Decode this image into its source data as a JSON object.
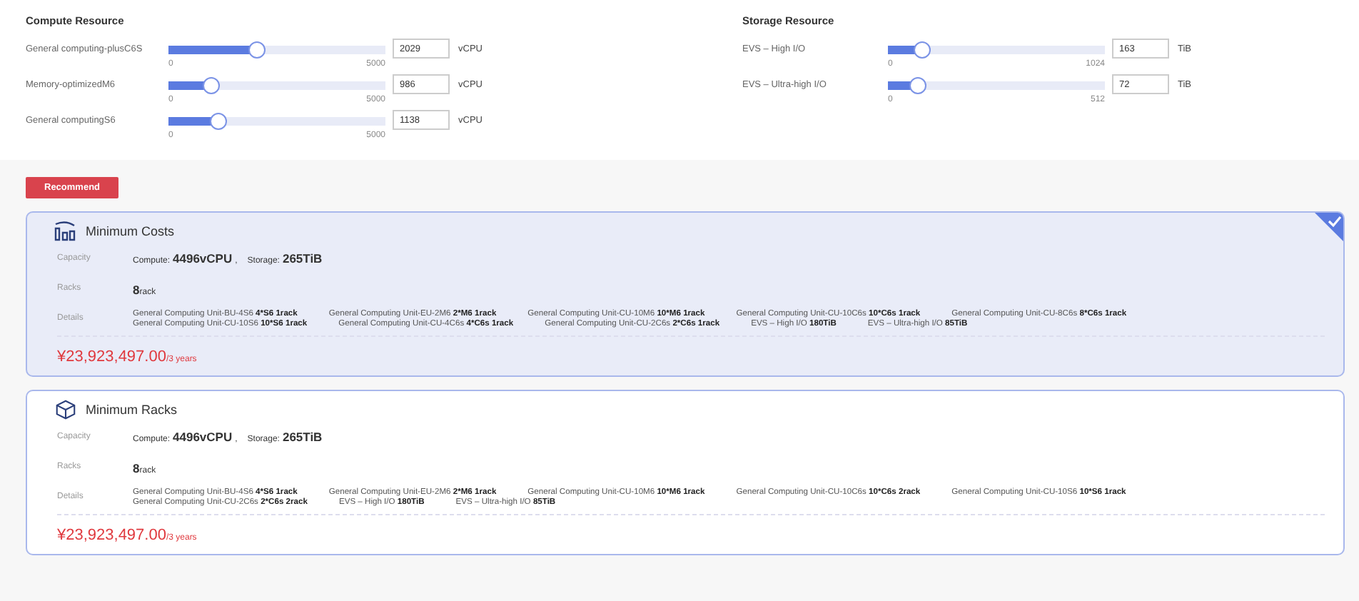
{
  "resource_groups": [
    {
      "title": "Compute Resource",
      "sliders": [
        {
          "label": "General computing-plusC6S",
          "level": 0.406,
          "min": "0",
          "max": "5000",
          "value": "2029",
          "unit": "vCPU"
        },
        {
          "label": "Memory-optimizedM6",
          "level": 0.197,
          "min": "0",
          "max": "5000",
          "value": "986",
          "unit": "vCPU"
        },
        {
          "label": "General computingS6",
          "level": 0.228,
          "min": "0",
          "max": "5000",
          "value": "1138",
          "unit": "vCPU"
        }
      ]
    },
    {
      "title": "Storage Resource",
      "sliders": [
        {
          "label": "EVS – High I/O",
          "level": 0.159,
          "min": "0",
          "max": "1024",
          "value": "163",
          "unit": "TiB"
        },
        {
          "label": "EVS – Ultra-high I/O",
          "level": 0.14,
          "min": "0",
          "max": "512",
          "value": "72",
          "unit": "TiB"
        }
      ]
    }
  ],
  "recommend_button": "Recommend",
  "plans": [
    {
      "kind": "costs",
      "title": "Minimum Costs",
      "selected": true,
      "capacity_label": "Capacity",
      "capacity": [
        {
          "label": "Compute:",
          "value": "4496vCPU"
        },
        {
          "label": "Storage:",
          "value": "265TiB"
        }
      ],
      "capacity_separator": ",",
      "racks_label": "Racks",
      "racks": {
        "value": "8",
        "unit": "rack"
      },
      "details_label": "Details",
      "details": [
        {
          "name": "General Computing Unit-BU-4S6",
          "qty": "4*S6 1rack"
        },
        {
          "name": "General Computing Unit-EU-2M6",
          "qty": "2*M6 1rack"
        },
        {
          "name": "General Computing Unit-CU-10M6",
          "qty": "10*M6 1rack"
        },
        {
          "name": "General Computing Unit-CU-10C6s",
          "qty": "10*C6s 1rack"
        },
        {
          "name": "General Computing Unit-CU-8C6s",
          "qty": "8*C6s 1rack"
        },
        {
          "name": "General Computing Unit-CU-10S6",
          "qty": "10*S6 1rack"
        },
        {
          "name": "General Computing Unit-CU-4C6s",
          "qty": "4*C6s 1rack"
        },
        {
          "name": "General Computing Unit-CU-2C6s",
          "qty": "2*C6s 1rack"
        },
        {
          "name": "EVS – High I/O",
          "qty": "180TiB"
        },
        {
          "name": "EVS – Ultra-high I/O",
          "qty": "85TiB"
        }
      ],
      "price": "¥23,923,497.00",
      "period": "/3 years"
    },
    {
      "kind": "racks",
      "title": "Minimum Racks",
      "selected": false,
      "capacity_label": "Capacity",
      "capacity": [
        {
          "label": "Compute:",
          "value": "4496vCPU"
        },
        {
          "label": "Storage:",
          "value": "265TiB"
        }
      ],
      "capacity_separator": ",",
      "racks_label": "Racks",
      "racks": {
        "value": "8",
        "unit": "rack"
      },
      "details_label": "Details",
      "details": [
        {
          "name": "General Computing Unit-BU-4S6",
          "qty": "4*S6 1rack"
        },
        {
          "name": "General Computing Unit-EU-2M6",
          "qty": "2*M6 1rack"
        },
        {
          "name": "General Computing Unit-CU-10M6",
          "qty": "10*M6 1rack"
        },
        {
          "name": "General Computing Unit-CU-10C6s",
          "qty": "10*C6s 2rack"
        },
        {
          "name": "General Computing Unit-CU-10S6",
          "qty": "10*S6 1rack"
        },
        {
          "name": "General Computing Unit-CU-2C6s",
          "qty": "2*C6s 2rack"
        },
        {
          "name": "EVS – High I/O",
          "qty": "180TiB"
        },
        {
          "name": "EVS – Ultra-high I/O",
          "qty": "85TiB"
        }
      ],
      "price": "¥23,923,497.00",
      "period": "/3 years"
    }
  ]
}
